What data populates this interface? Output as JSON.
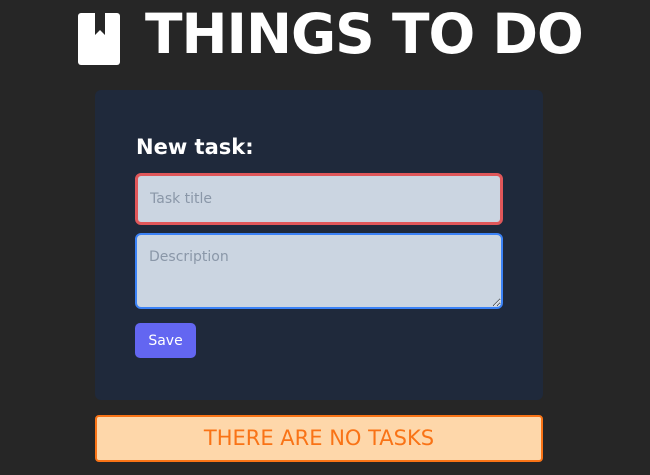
{
  "header": {
    "title": "THINGS TO DO",
    "icon": "book-icon"
  },
  "form": {
    "heading": "New task:",
    "title_field": {
      "value": "",
      "placeholder": "Task title"
    },
    "description_field": {
      "value": "",
      "placeholder": "Description"
    },
    "save_label": "Save"
  },
  "tasks": {
    "empty_message": "THERE ARE NO TASKS"
  },
  "colors": {
    "background": "#262626",
    "card": "#1f293b",
    "input_background": "#cbd5e1",
    "title_field_border": "#e0575a",
    "description_field_border": "#3b82f6",
    "save_button": "#6366f1",
    "empty_banner_background": "#fed7aa",
    "empty_banner_accent": "#f97316"
  }
}
